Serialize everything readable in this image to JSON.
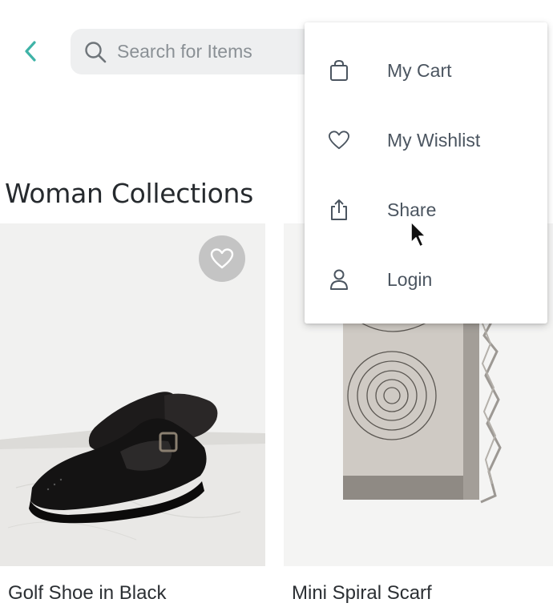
{
  "header": {
    "back_icon": "chevron-left-icon",
    "back_color": "#3fb3a7",
    "search": {
      "icon": "search-icon",
      "placeholder": "Search for Items",
      "value": ""
    }
  },
  "section": {
    "title": "Woman Collections"
  },
  "products": [
    {
      "name": "Golf Shoe in Black",
      "wishlist_icon": "heart-icon"
    },
    {
      "name": "Mini Spiral Scarf"
    }
  ],
  "menu": {
    "items": [
      {
        "label": "My Cart",
        "icon": "shopping-bag-icon"
      },
      {
        "label": "My Wishlist",
        "icon": "heart-icon"
      },
      {
        "label": "Share",
        "icon": "share-icon"
      },
      {
        "label": "Login",
        "icon": "user-icon"
      }
    ]
  }
}
